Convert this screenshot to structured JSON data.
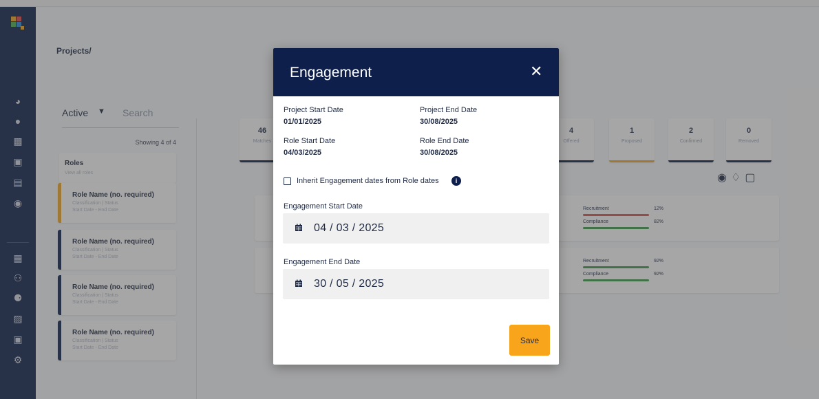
{
  "breadcrumb": "Projects/",
  "filter": {
    "status": "Active",
    "search_placeholder": "Search"
  },
  "showing": "Showing 4 of 4",
  "roles_header": {
    "title": "Roles",
    "subtitle": "View all roles"
  },
  "role_cards": [
    {
      "name": "Role Name (no. required)",
      "classification": "Classification | Status",
      "dates": "Start Date - End Date",
      "accent": "#f0a92a"
    },
    {
      "name": "Role Name (no. required)",
      "classification": "Classification | Status",
      "dates": "Start Date - End Date",
      "accent": "#0d1f4a"
    },
    {
      "name": "Role Name (no. required)",
      "classification": "Classification | Status",
      "dates": "Start Date - End Date",
      "accent": "#0d1f4a"
    },
    {
      "name": "Role Name (no. required)",
      "classification": "Classification | Status",
      "dates": "Start Date - End Date",
      "accent": "#0d1f4a"
    }
  ],
  "stats": [
    {
      "count": "46",
      "label": "Matches"
    },
    {
      "count": "4",
      "label": "Offered"
    },
    {
      "count": "1",
      "label": "Proposed"
    },
    {
      "count": "2",
      "label": "Confirmed"
    },
    {
      "count": "0",
      "label": "Removed"
    }
  ],
  "candidates": [
    {
      "metrics": [
        {
          "name": "Recruitment",
          "value": "12%"
        },
        {
          "name": "Compliance",
          "value": "82%"
        }
      ]
    },
    {
      "metrics": [
        {
          "name": "Recruitment",
          "value": "92%"
        },
        {
          "name": "Compliance",
          "value": "92%"
        }
      ]
    }
  ],
  "modal": {
    "title": "Engagement",
    "project_start_label": "Project Start Date",
    "project_start_value": "01/01/2025",
    "project_end_label": "Project End Date",
    "project_end_value": "30/08/2025",
    "role_start_label": "Role Start Date",
    "role_start_value": "04/03/2025",
    "role_end_label": "Role End Date",
    "role_end_value": "30/08/2025",
    "inherit_label": "Inherit Engagement dates from Role dates",
    "inherit_checked": false,
    "engagement_start_label": "Engagement Start Date",
    "engagement_start_value": "04 / 03 / 2025",
    "engagement_end_label": "Engagement End Date",
    "engagement_end_value": "30 / 05 / 2025",
    "save_label": "Save"
  },
  "colors": {
    "navy": "#0d1f4a",
    "accent_orange": "#f9a51b",
    "metric_red": "#d9534f",
    "metric_green": "#3c9a4a"
  },
  "icons": {
    "sidebar": [
      "dashboard-icon",
      "person-icon",
      "chart-icon",
      "id-card-icon",
      "document-icon",
      "chat-icon",
      "calendar-icon",
      "group-icon",
      "users-icon",
      "briefcase-icon",
      "id-card-icon",
      "settings-icon"
    ],
    "actions": [
      "globe-icon",
      "tag-icon",
      "note-icon"
    ]
  }
}
